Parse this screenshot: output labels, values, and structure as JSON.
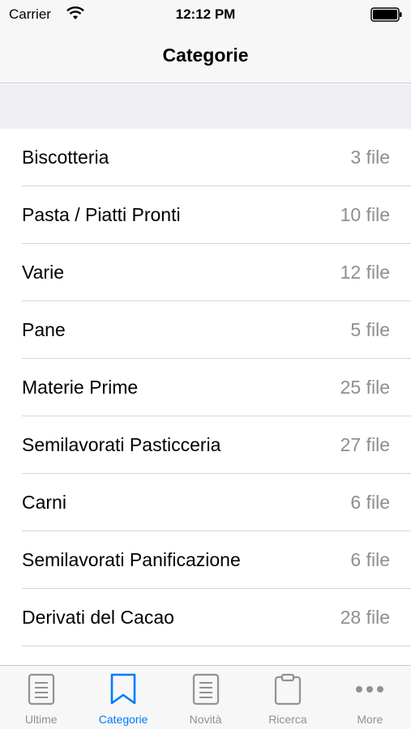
{
  "status_bar": {
    "carrier": "Carrier",
    "time": "12:12 PM"
  },
  "nav": {
    "title": "Categorie"
  },
  "categories": [
    {
      "name": "Biscotteria",
      "count": "3 file"
    },
    {
      "name": "Pasta / Piatti Pronti",
      "count": "10 file"
    },
    {
      "name": "Varie",
      "count": "12 file"
    },
    {
      "name": "Pane",
      "count": "5 file"
    },
    {
      "name": "Materie Prime",
      "count": "25 file"
    },
    {
      "name": "Semilavorati Pasticceria",
      "count": "27 file"
    },
    {
      "name": "Carni",
      "count": "6 file"
    },
    {
      "name": "Semilavorati Panificazione",
      "count": "6 file"
    },
    {
      "name": "Derivati del Cacao",
      "count": "28 file"
    }
  ],
  "tabs": [
    {
      "label": "Ultime",
      "icon": "document-icon",
      "active": false
    },
    {
      "label": "Categorie",
      "icon": "bookmark-icon",
      "active": true
    },
    {
      "label": "Novità",
      "icon": "document-icon",
      "active": false
    },
    {
      "label": "Ricerca",
      "icon": "clipboard-icon",
      "active": false
    },
    {
      "label": "More",
      "icon": "more-icon",
      "active": false
    }
  ],
  "colors": {
    "accent": "#007aff",
    "inactive": "#929292",
    "secondary_text": "#8e8e93"
  }
}
